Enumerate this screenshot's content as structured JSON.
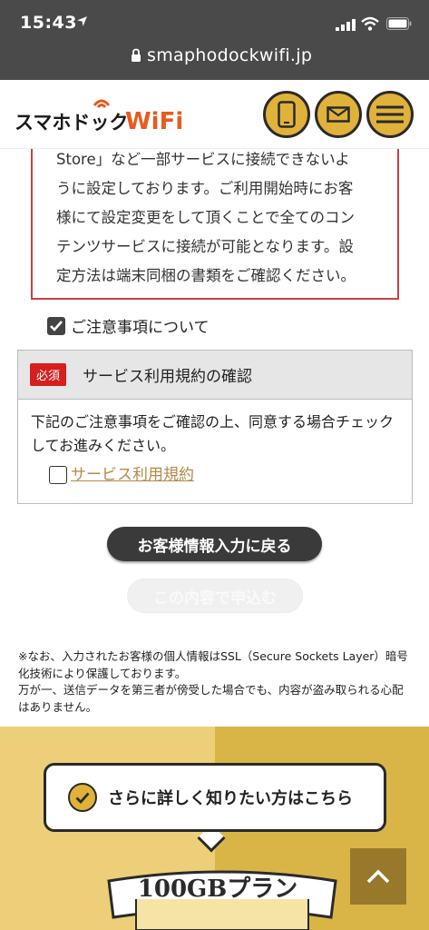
{
  "status_bar": {
    "time": "15:43"
  },
  "browser": {
    "url": "smaphodockwifi.jp"
  },
  "header": {
    "logo_text_1": "スマホドック",
    "logo_text_2": "WiFi",
    "phone_button": "phone-icon",
    "mail_button": "mail-icon",
    "menu_button": "hamburger-icon"
  },
  "notice": {
    "lines": [
      "Store」など一部サービスに接続できないよ",
      "うに設定しております。ご利用開始時にお客",
      "様にて設定変更をして頂くことで全てのコン",
      "テンツサービスに接続が可能となります。設",
      "定方法は端末同梱の書類をご確認ください。"
    ]
  },
  "notes_check": {
    "label": "ご注意事項について",
    "checked": true
  },
  "agreement": {
    "badge": "必須",
    "title": "サービス利用規約の確認",
    "body": "下記のご注意事項をご確認の上、同意する場合チェックしてお進みください。",
    "terms_link": "サービス利用規約",
    "terms_checked": false
  },
  "buttons": {
    "back": "お客様情報入力に戻る",
    "submit": "この内容で申込む"
  },
  "footnote": {
    "line1": "※なお、入力されたお客様の個人情報はSSL（Secure Sockets Layer）暗号化技術により保護しております。",
    "line2": "万が一、送信データを第三者が傍受した場合でも、内容が盗み取られる心配はありません。"
  },
  "promo": {
    "bubble_text": "さらに詳しく知りたい方はこちら",
    "plan": "100GBプラン"
  },
  "colors": {
    "gold": "#e0b23a",
    "required_red": "#d61f1f",
    "notice_border": "#c94040",
    "link": "#b48a48"
  }
}
